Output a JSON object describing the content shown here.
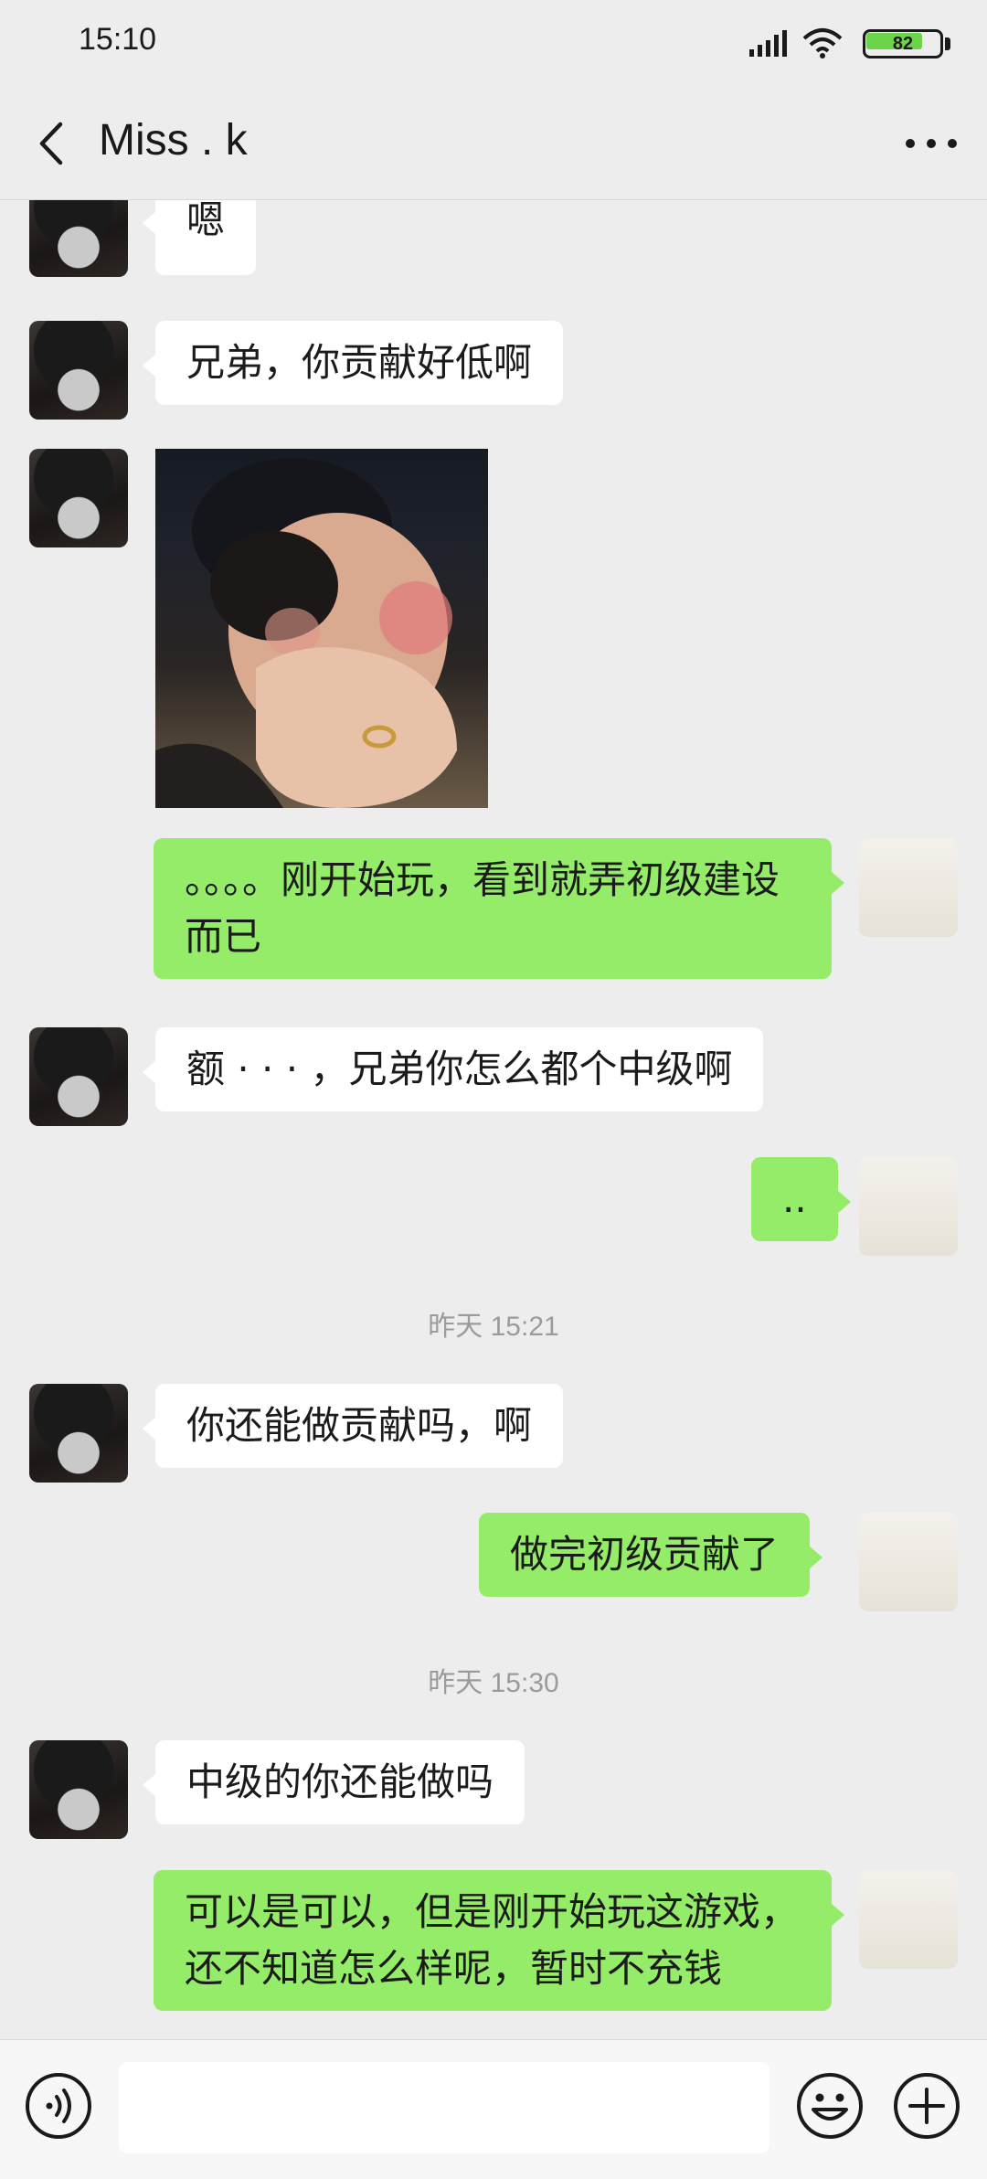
{
  "status_bar": {
    "time": "15:10",
    "battery_level": "82",
    "icons": [
      "signal-icon",
      "wifi-icon",
      "battery-icon"
    ]
  },
  "header": {
    "title": "Miss . k",
    "back_icon": "chevron-left-icon",
    "more_icon": "more-dots-icon"
  },
  "messages": [
    {
      "side": "left",
      "type": "text",
      "text": "嗯"
    },
    {
      "side": "left",
      "type": "text",
      "text": "兄弟，你贡献好低啊"
    },
    {
      "side": "left",
      "type": "image"
    },
    {
      "side": "right",
      "type": "text",
      "text": "。。。。刚开始玩，看到就弄初级建设而已"
    },
    {
      "side": "left",
      "type": "text",
      "text": "额 · · · ，兄弟你怎么都个中级啊"
    },
    {
      "side": "right",
      "type": "text",
      "text": ".."
    },
    {
      "type": "time",
      "text": "昨天 15:21"
    },
    {
      "side": "left",
      "type": "text",
      "text": "你还能做贡献吗，啊"
    },
    {
      "side": "right",
      "type": "text",
      "text": "做完初级贡献了"
    },
    {
      "type": "time",
      "text": "昨天 15:30"
    },
    {
      "side": "left",
      "type": "text",
      "text": "中级的你还能做吗"
    },
    {
      "side": "right",
      "type": "text",
      "text": "可以是可以，但是刚开始玩这游戏，还不知道怎么样呢，暂时不充钱"
    }
  ],
  "input_bar": {
    "input_value": "",
    "icons": [
      "voice-icon",
      "emoji-icon",
      "plus-icon"
    ]
  },
  "colors": {
    "background": "#ededed",
    "bubble_right": "#95ec69",
    "bubble_left": "#ffffff"
  }
}
